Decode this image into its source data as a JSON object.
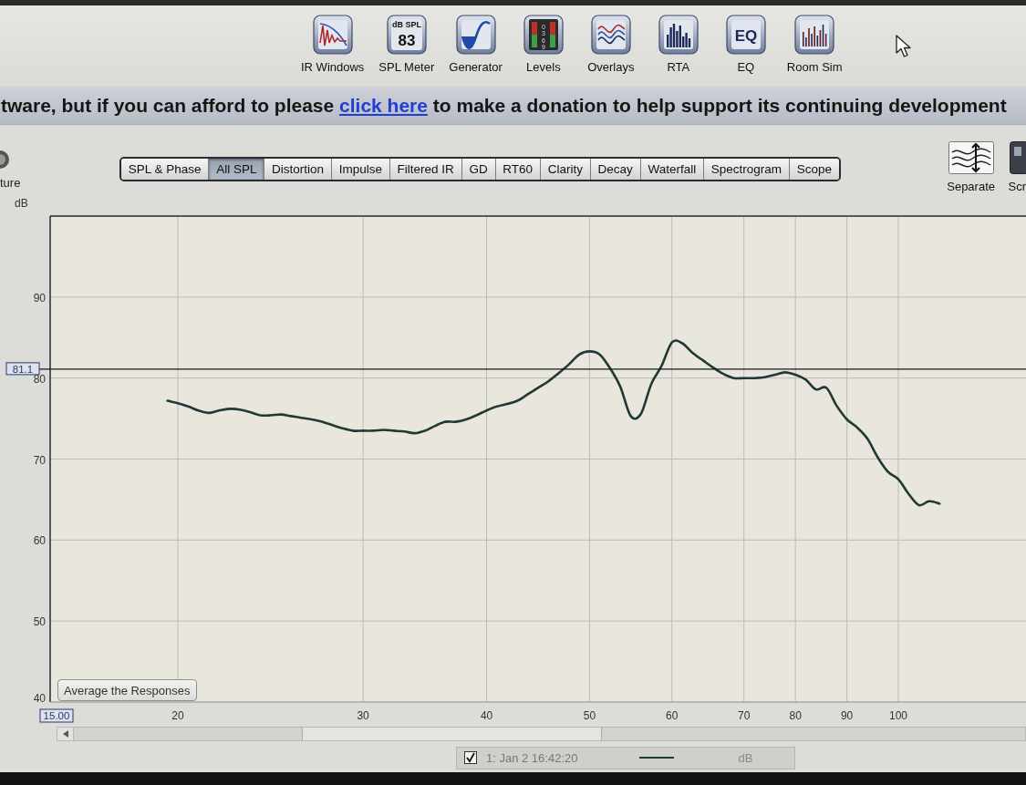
{
  "toolbar": {
    "items": [
      {
        "label": "IR Windows",
        "kind": "ir_windows"
      },
      {
        "label": "SPL Meter",
        "kind": "spl_meter",
        "icon_text": [
          "dB SPL",
          "83"
        ]
      },
      {
        "label": "Generator",
        "kind": "generator"
      },
      {
        "label": "Levels",
        "kind": "levels",
        "icon_text": [
          "0369"
        ]
      },
      {
        "label": "Overlays",
        "kind": "overlays"
      },
      {
        "label": "RTA",
        "kind": "rta"
      },
      {
        "label": "EQ",
        "kind": "eq",
        "icon_text": [
          "EQ"
        ]
      },
      {
        "label": "Room Sim",
        "kind": "room_sim"
      }
    ]
  },
  "banner": {
    "text_before": "tware, but if you can afford to please",
    "link": "click here",
    "text_after": "to make a donation to help support its continuing development"
  },
  "left_panel": {
    "label": "ture"
  },
  "graph_tabs": [
    {
      "label": "SPL & Phase",
      "selected": false
    },
    {
      "label": "All SPL",
      "selected": true
    },
    {
      "label": "Distortion",
      "selected": false
    },
    {
      "label": "Impulse",
      "selected": false
    },
    {
      "label": "Filtered IR",
      "selected": false
    },
    {
      "label": "GD",
      "selected": false
    },
    {
      "label": "RT60",
      "selected": false
    },
    {
      "label": "Clarity",
      "selected": false
    },
    {
      "label": "Decay",
      "selected": false
    },
    {
      "label": "Waterfall",
      "selected": false
    },
    {
      "label": "Spectrogram",
      "selected": false
    },
    {
      "label": "Scope",
      "selected": false
    }
  ],
  "right_buttons": [
    {
      "label": "Separate",
      "kind": "separate"
    },
    {
      "label": "Scr",
      "kind": "cut_off"
    }
  ],
  "graph": {
    "average_button": "Average the Responses",
    "chart_data": {
      "type": "line",
      "ylabel": "dB",
      "grid": true,
      "categories": [
        null,
        null,
        null,
        null,
        null,
        null,
        null,
        null,
        null,
        null,
        null,
        null,
        "20",
        null,
        null,
        null,
        null,
        null,
        null,
        null,
        null,
        null,
        null,
        null,
        null,
        null,
        null,
        null,
        null,
        null,
        "30",
        null,
        null,
        null,
        null,
        null,
        null,
        null,
        null,
        null,
        null,
        null,
        "40",
        null,
        null,
        null,
        null,
        null,
        null,
        null,
        null,
        null,
        "50",
        null,
        null,
        null,
        null,
        null,
        null,
        null,
        "60",
        null,
        null,
        null,
        null,
        null,
        null,
        "70",
        null,
        null,
        null,
        null,
        "80",
        null,
        null,
        null,
        null,
        "90",
        null,
        null,
        null,
        null,
        "100",
        null,
        null,
        null,
        null,
        null,
        null,
        null,
        null,
        null,
        null,
        null,
        null
      ],
      "series": [
        {
          "name": "1: Jan 2 16:42:20",
          "color": "#1f3a36",
          "values": [
            null,
            null,
            null,
            null,
            null,
            null,
            null,
            null,
            null,
            null,
            null,
            77.2,
            76.9,
            76.5,
            76.0,
            75.7,
            76.0,
            76.2,
            76.1,
            75.8,
            75.4,
            75.4,
            75.5,
            75.3,
            75.1,
            74.9,
            74.6,
            74.2,
            73.8,
            73.5,
            73.5,
            73.5,
            73.6,
            73.5,
            73.4,
            73.2,
            73.5,
            74.1,
            74.6,
            74.6,
            74.9,
            75.4,
            76.0,
            76.5,
            76.8,
            77.2,
            78.0,
            78.8,
            79.6,
            80.6,
            81.7,
            82.9,
            83.3,
            82.9,
            81.2,
            78.9,
            75.3,
            75.6,
            79.3,
            81.5,
            84.4,
            84.3,
            83.1,
            82.2,
            81.3,
            80.5,
            80.0,
            80.0,
            80.0,
            80.1,
            80.4,
            80.7,
            80.4,
            79.8,
            78.6,
            78.8,
            76.6,
            74.9,
            73.9,
            72.5,
            70.2,
            68.4,
            67.5,
            65.7,
            64.3,
            64.8,
            64.5,
            null,
            null,
            null,
            null,
            null,
            null,
            null,
            null
          ]
        }
      ],
      "ylim": [
        40,
        100
      ],
      "yticks": [
        40,
        50,
        60,
        70,
        80,
        90
      ],
      "ref_lines": [
        {
          "axis": "y",
          "value": 81.1,
          "label": "81.1"
        }
      ],
      "annotations": [
        "15.00"
      ]
    },
    "legend": [
      {
        "checked": true,
        "unit": "dB"
      }
    ]
  }
}
